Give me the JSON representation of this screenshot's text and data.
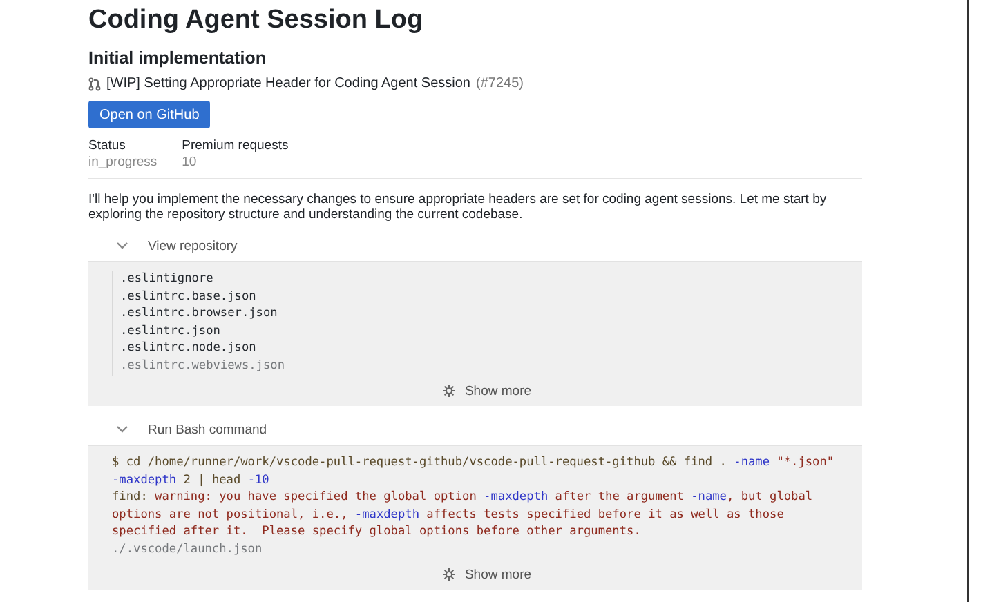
{
  "title": "Coding Agent Session Log",
  "subtitle": "Initial implementation",
  "pull_request": {
    "title": "[WIP] Setting Appropriate Header for Coding Agent Session",
    "number": "(#7245)"
  },
  "open_button": "Open on GitHub",
  "stats": [
    {
      "label": "Status",
      "value": "in_progress"
    },
    {
      "label": "Premium requests",
      "value": "10"
    }
  ],
  "message": "I'll help you implement the necessary changes to ensure appropriate headers are set for coding agent sessions. Let me start by exploring the repository structure and understanding the current codebase.",
  "steps": [
    {
      "title": "View repository",
      "expanded": true,
      "kind": "listing",
      "show_more": "Show more",
      "lines": [
        {
          "faded": false,
          "segments": [
            {
              "text": ".eslintignore",
              "kind": "plain"
            }
          ]
        },
        {
          "faded": false,
          "segments": [
            {
              "text": ".eslintrc.base.json",
              "kind": "plain"
            }
          ]
        },
        {
          "faded": false,
          "segments": [
            {
              "text": ".eslintrc.browser.json",
              "kind": "plain"
            }
          ]
        },
        {
          "faded": false,
          "segments": [
            {
              "text": ".eslintrc.json",
              "kind": "plain"
            }
          ]
        },
        {
          "faded": false,
          "segments": [
            {
              "text": ".eslintrc.node.json",
              "kind": "plain"
            }
          ]
        },
        {
          "faded": true,
          "segments": [
            {
              "text": ".eslintrc.webviews.json",
              "kind": "plain"
            }
          ]
        }
      ]
    },
    {
      "title": "Run Bash command",
      "expanded": true,
      "kind": "shell",
      "show_more": "Show more",
      "lines": [
        {
          "faded": false,
          "segments": [
            {
              "text": "$ cd /home/runner/work/vscode-pull-request-github/vscode-pull-request-github && find . ",
              "kind": "command"
            },
            {
              "text": "-name",
              "kind": "flag"
            },
            {
              "text": " \"*.json\"",
              "kind": "warning"
            }
          ]
        },
        {
          "faded": false,
          "segments": [
            {
              "text": "-maxdepth",
              "kind": "flag"
            },
            {
              "text": " 2 | head ",
              "kind": "command"
            },
            {
              "text": "-10",
              "kind": "flag"
            }
          ]
        },
        {
          "faded": false,
          "segments": [
            {
              "text": "find: ",
              "kind": "command"
            },
            {
              "text": "warning: you have specified the global option ",
              "kind": "warning"
            },
            {
              "text": "-maxdepth",
              "kind": "flag"
            },
            {
              "text": " after the argument ",
              "kind": "warning"
            },
            {
              "text": "-name",
              "kind": "flag"
            },
            {
              "text": ", but global",
              "kind": "warning"
            }
          ]
        },
        {
          "faded": false,
          "segments": [
            {
              "text": "options are not positional, i.e., ",
              "kind": "warning"
            },
            {
              "text": "-maxdepth",
              "kind": "flag"
            },
            {
              "text": " affects tests specified before it as well as those",
              "kind": "warning"
            }
          ]
        },
        {
          "faded": false,
          "segments": [
            {
              "text": "specified after it.  Please specify global options before other arguments.",
              "kind": "warning"
            }
          ]
        },
        {
          "faded": true,
          "segments": [
            {
              "text": "./.vscode/launch.json",
              "kind": "plain"
            }
          ]
        }
      ]
    }
  ]
}
